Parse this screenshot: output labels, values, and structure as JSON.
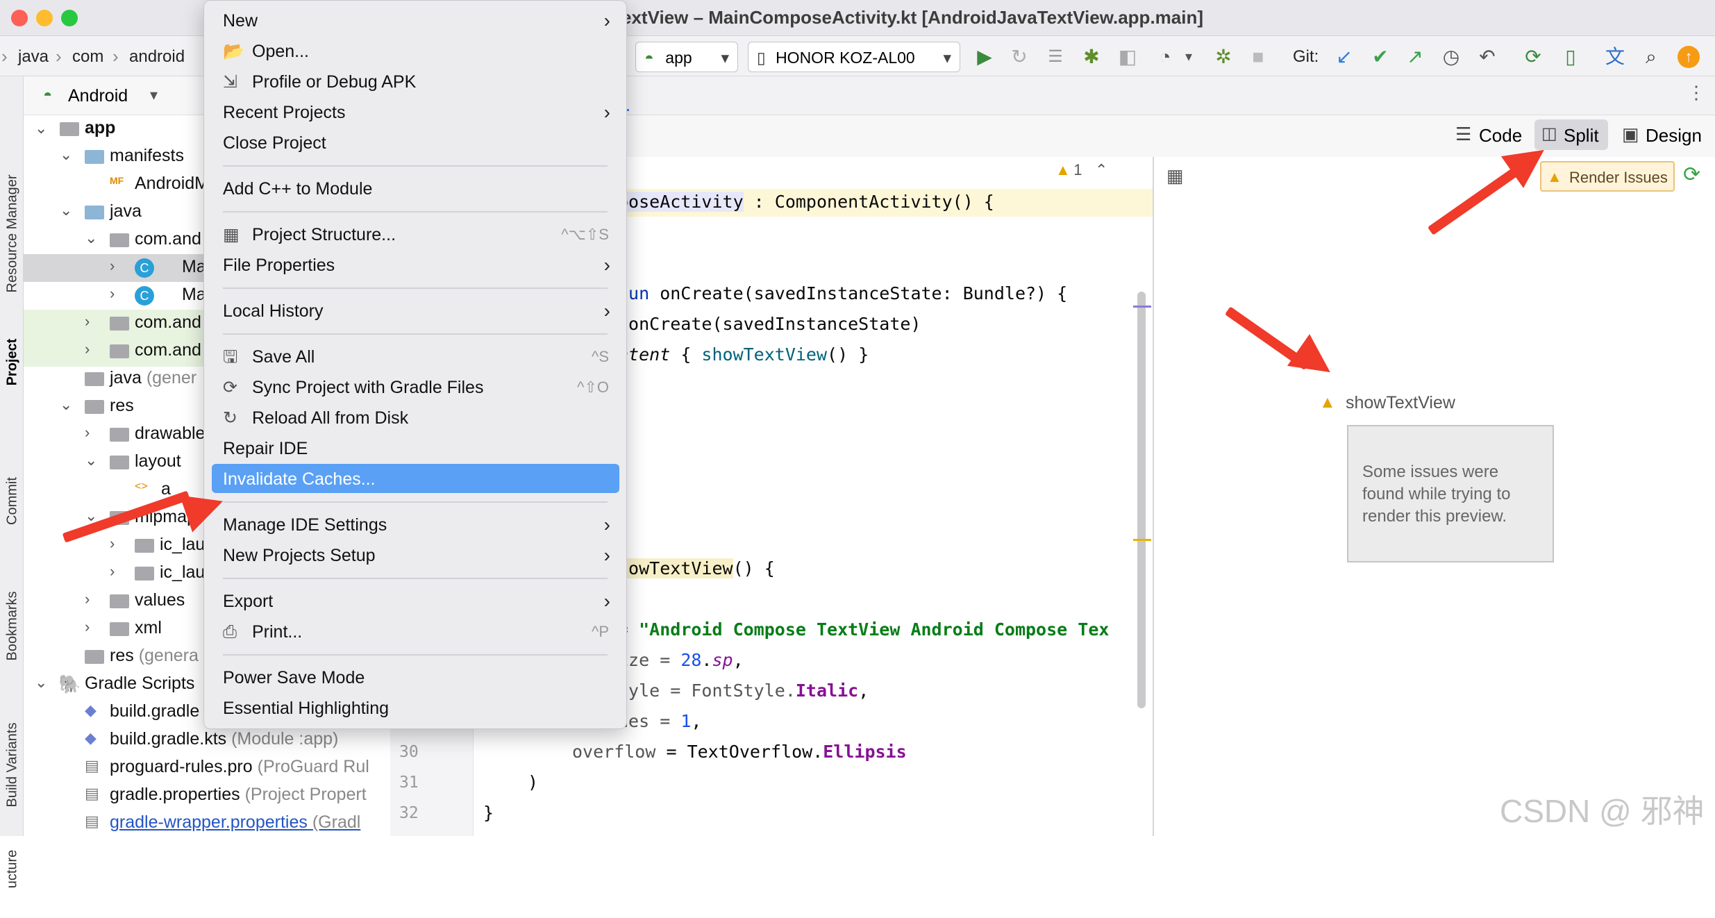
{
  "window": {
    "title": "extView – MainComposeActivity.kt [AndroidJavaTextView.app.main]"
  },
  "breadcrumb": [
    "java",
    "com",
    "android"
  ],
  "toolbar": {
    "run_config": "app",
    "device": "HONOR KOZ-AL00",
    "git_label": "Git:"
  },
  "left_strip": [
    "Resource Manager",
    "Project",
    "Commit",
    "Bookmarks",
    "Build Variants",
    "ucture"
  ],
  "project_view": {
    "selector": "Android",
    "tree": [
      {
        "label": "app",
        "bold": true
      },
      {
        "label": "manifests"
      },
      {
        "label": "AndroidM"
      },
      {
        "label": "java"
      },
      {
        "label": "com.and"
      },
      {
        "label": "Ma"
      },
      {
        "label": "Ma"
      },
      {
        "label": "com.and"
      },
      {
        "label": "com.and"
      },
      {
        "label": "java",
        "suffix": "(gener"
      },
      {
        "label": "res"
      },
      {
        "label": "drawable"
      },
      {
        "label": "layout"
      },
      {
        "label": "a"
      },
      {
        "label": "mipmap"
      },
      {
        "label": "ic_lau"
      },
      {
        "label": "ic_lau"
      },
      {
        "label": "values"
      },
      {
        "label": "xml"
      },
      {
        "label": "res",
        "suffix": "(genera"
      },
      {
        "label": "Gradle Scripts"
      },
      {
        "label": "build.gradle"
      },
      {
        "label": "build.gradle.kts",
        "suffix": "(Module :app)"
      },
      {
        "label": "proguard-rules.pro",
        "suffix": "(ProGuard Rul"
      },
      {
        "label": "gradle.properties",
        "suffix": "(Project Propert"
      },
      {
        "label": "gradle-wrapper.properties",
        "suffix": "(Gradl"
      }
    ]
  },
  "editor": {
    "warnings_count": "1",
    "line_numbers": [
      "30",
      "31",
      "32"
    ],
    "code": {
      "l1a": "poseActivity",
      "l1b": " : ComponentActivity() {",
      "l2kw": "fun",
      "l2": " onCreate(savedInstanceState: Bundle?) {",
      "l3": ".onCreate(savedInstanceState)",
      "l4a": "ntent",
      "l4b": " { ",
      "l4c": "showTextView",
      "l4d": "() }",
      "l5a": "howTextView",
      "l5b": "() {",
      "l6a": "= ",
      "l6b": "\"Android Compose TextView Android Compose Tex",
      "l7a": "ize = ",
      "l7b": "28",
      "l7c": ".",
      "l7d": "sp",
      "l7e": ",",
      "l8a": "tyle = FontStyle.",
      "l8b": "Italic",
      "l8c": ",",
      "l9a": "nes = ",
      "l9b": "1",
      "l9c": ",",
      "l10a": "overflow",
      "l10b": " = TextOverflow.",
      "l10c": "Ellipsis",
      "l11": ")",
      "l12": "}"
    }
  },
  "view_modes": {
    "code": "Code",
    "split": "Split",
    "design": "Design"
  },
  "preview": {
    "render_issues": "Render Issues",
    "preview_name": "showTextView",
    "message": "Some issues were found while trying to render this preview."
  },
  "menu": {
    "items": [
      {
        "label": "New",
        "submenu": true
      },
      {
        "label": "Open...",
        "icon": "folder-icon"
      },
      {
        "label": "Profile or Debug APK",
        "icon": "profile-icon"
      },
      {
        "label": "Recent Projects",
        "submenu": true
      },
      {
        "label": "Close Project"
      },
      {
        "label": "Add C++ to Module"
      },
      {
        "label": "Project Structure...",
        "icon": "project-structure-icon",
        "shortcut": "^⌥⇧S"
      },
      {
        "label": "File Properties",
        "submenu": true
      },
      {
        "label": "Local History",
        "submenu": true
      },
      {
        "label": "Save All",
        "icon": "save-icon",
        "shortcut": "^S"
      },
      {
        "label": "Sync Project with Gradle Files",
        "icon": "gradle-sync-icon",
        "shortcut": "^⇧O"
      },
      {
        "label": "Reload All from Disk",
        "icon": "reload-icon"
      },
      {
        "label": "Repair IDE"
      },
      {
        "label": "Invalidate Caches...",
        "highlighted": true
      },
      {
        "label": "Manage IDE Settings",
        "submenu": true
      },
      {
        "label": "New Projects Setup",
        "submenu": true
      },
      {
        "label": "Export",
        "submenu": true
      },
      {
        "label": "Print...",
        "icon": "print-icon",
        "shortcut": "^P"
      },
      {
        "label": "Power Save Mode"
      },
      {
        "label": "Essential Highlighting"
      }
    ]
  },
  "watermark": "CSDN @ 邪神"
}
